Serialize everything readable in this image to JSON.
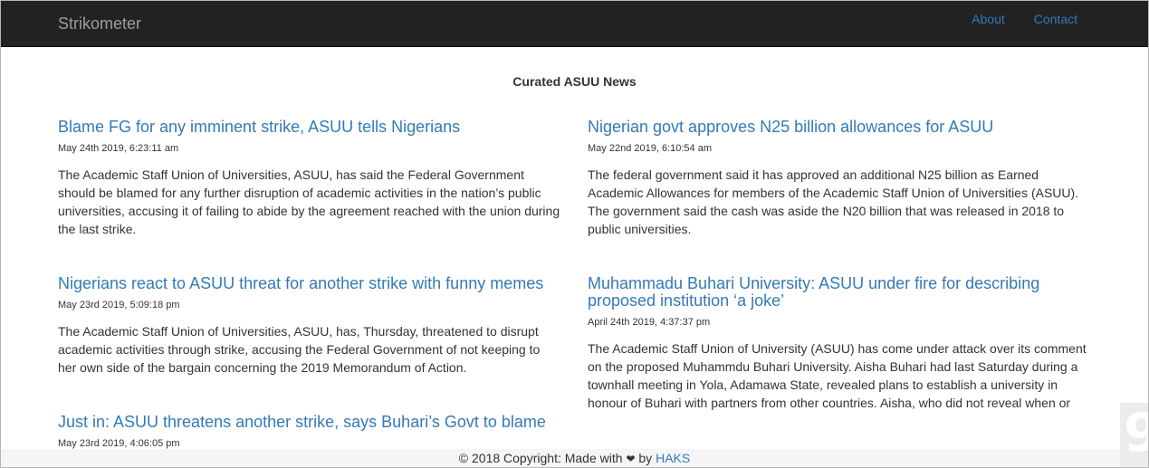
{
  "navbar": {
    "brand": "Strikometer",
    "links": [
      {
        "label": "About"
      },
      {
        "label": "Contact"
      }
    ]
  },
  "page": {
    "title": "Curated ASUU News"
  },
  "articles": [
    {
      "headline": "Blame FG for any imminent strike, ASUU tells Nigerians",
      "date": "May 24th 2019, 6:23:11 am",
      "summary": "The Academic Staff Union of Universities, ASUU, has said the Federal Government should be blamed for any further disruption of academic activities in the nation’s public universities, accusing it of failing to abide by the agreement reached with the union during the last strike."
    },
    {
      "headline": "Nigerian govt approves N25 billion allowances for ASUU",
      "date": "May 22nd 2019, 6:10:54 am",
      "summary": "The federal government said it has approved an additional N25 billion as Earned Academic Allowances for members of the Academic Staff Union of Universities (ASUU). The government said the cash was aside the N20 billion that was released in 2018 to public universities."
    },
    {
      "headline": "Nigerians react to ASUU threat for another strike with funny memes",
      "date": "May 23rd 2019, 5:09:18 pm",
      "summary": "The Academic Staff Union of Universities, ASUU, has, Thursday, threatened to disrupt academic activities through strike, accusing the Federal Government of not keeping to her own side of the bargain concerning the 2019 Memorandum of Action."
    },
    {
      "headline": "Muhammadu Buhari University: ASUU under fire for describing proposed institution ‘a joke’",
      "date": "April 24th 2019, 4:37:37 pm",
      "summary": "The Academic Staff Union of University (ASUU) has come under attack over its comment on the proposed Muhammdu Buhari University. Aisha Buhari had last Saturday during a townhall meeting in Yola, Adamawa State, revealed plans to establish a university in honour of Buhari with partners from other countries. Aisha, who did not reveal when or"
    },
    {
      "headline": "Just in: ASUU threatens another strike, says Buhari’s Govt to blame",
      "date": "May 23rd 2019, 4:06:05 pm",
      "summary": ""
    }
  ],
  "footer": {
    "text": "© 2018 Copyright: Made with",
    "heart": "❤",
    "by": "by",
    "author": "HAKS"
  },
  "widget": {
    "glyph": "9"
  }
}
